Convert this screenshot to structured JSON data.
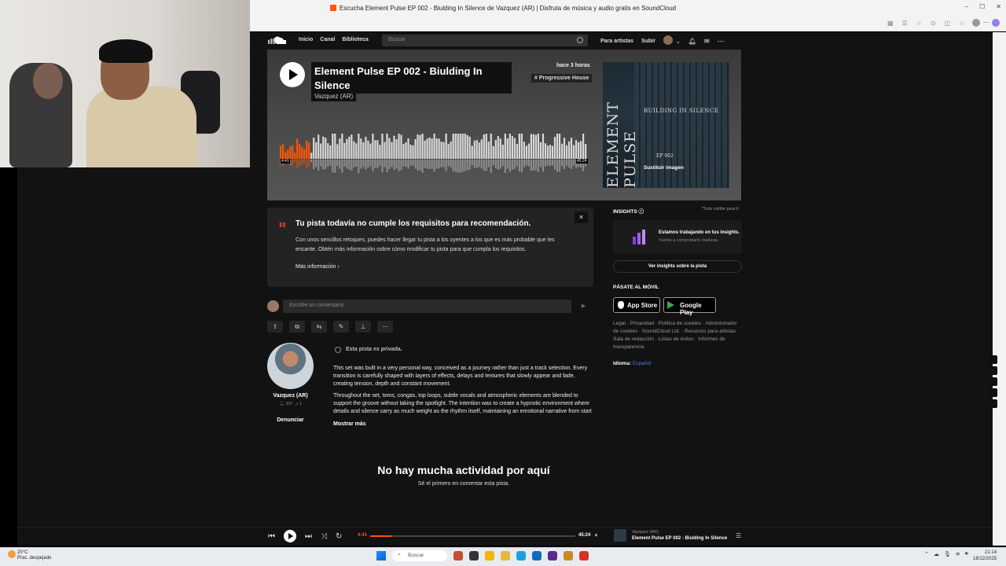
{
  "window": {
    "title": "Escucha Element Pulse EP 002 - Biulding In Silence de Vazquez (AR) | Disfruta de música y audio gratis en SoundCloud"
  },
  "nav": {
    "links": [
      "Inicio",
      "Canal",
      "Biblioteca"
    ],
    "search_placeholder": "Buscar",
    "for_artists": "Para artistas",
    "upload": "Subir"
  },
  "track": {
    "title": "Element Pulse EP 002 - Biulding In Silence",
    "artist": "Vazquez (AR)",
    "posted": "hace 3 horas",
    "genre": "# Progressive House",
    "elapsed": "4:41",
    "duration": "45:24",
    "progress": 0.103
  },
  "cover": {
    "vertical_text": "ELEMENT PULSE",
    "subtitle": "BUILDING IN SILENCE",
    "ep": "EP 002",
    "replace_label": "Sustituir imagen"
  },
  "notice": {
    "title": "Tu pista todavía no cumple los requisitos para recomendación.",
    "body": "Con unos sencillos retoques, puedes hacer llegar tu pista a los oyentes a los que es más probable que les encante. Obtén más información sobre cómo modificar tu pista para que cumpla los requisitos.",
    "more": "Más información",
    "close": "×"
  },
  "comment": {
    "placeholder": "Escribe un comentario"
  },
  "actions": [
    "share",
    "copy",
    "repost",
    "edit",
    "stats",
    "more"
  ],
  "profile": {
    "name": "Vazquez (AR)",
    "followers": "397",
    "following": "1",
    "report": "Denunciar"
  },
  "description": {
    "private": "Esta pista es privada.",
    "p1": "This set was built in a very personal way, conceived as a journey rather than just a track selection. Every transition is carefully shaped with layers of effects, delays and textures that slowly appear and fade, creating tension, depth and constant movement.",
    "p2": "Throughout the set, toms, congas, top loops, subtle vocals and atmospheric elements are blended to support the groove without taking the spotlight. The intention was to create a hypnotic environment where details and silence carry as much weight as the rhythm itself, maintaining an emotional narrative from start",
    "show_more": "Mostrar más"
  },
  "empty": {
    "title": "No hay mucha actividad por aquí",
    "subtitle": "Sé el primero en comentar esta pista."
  },
  "sidebar": {
    "insights_heading": "INSIGHTS",
    "insights_note": "*Solo visible para ti",
    "insights_title": "Estamos trabajando en tus insights.",
    "insights_sub": "Vuelve a comprobarlo mañana.",
    "insights_button": "Ver insights sobre la pista",
    "mobile_heading": "PÁSATE AL MÓVIL",
    "app_store": "App Store",
    "google_play": "Google Play",
    "legal": "Legal · Privacidad · Política de cookies · Administrador de cookies · SoundCloud Ltd. · Recursos para artistas · Sala de redacción · Listas de éxitos · Informes de transparencia",
    "language_label": "Idioma:",
    "language_value": "Español"
  },
  "player": {
    "current": "4:41",
    "total": "45:24",
    "artist": "Vazquez (AR)",
    "track": "Element Pulse EP 002 - Biulding In Silence"
  },
  "taskbar": {
    "temp": "20°C",
    "weather": "Prac. despejado",
    "search": "Buscar",
    "time": "21:14",
    "date": "18/12/2025"
  },
  "colors": {
    "accent": "#ff5500",
    "background": "#121212"
  }
}
